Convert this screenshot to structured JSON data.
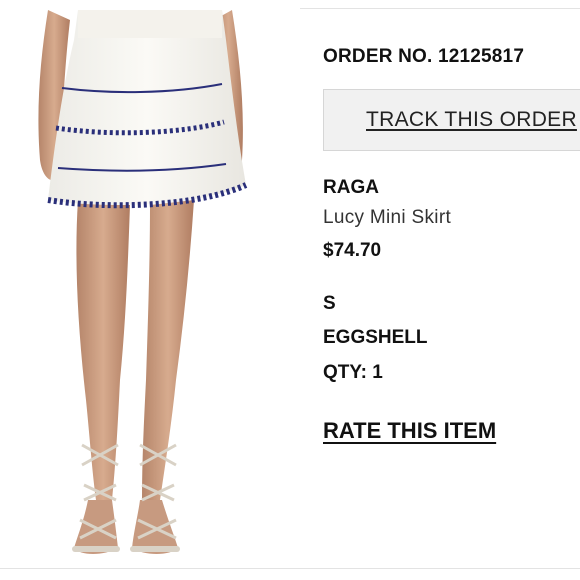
{
  "order": {
    "number_label": "ORDER NO. 12125817",
    "track_button": "TRACK THIS ORDER"
  },
  "item": {
    "brand": "RAGA",
    "name": "Lucy Mini Skirt",
    "price": "$74.70",
    "size": "S",
    "color": "EGGSHELL",
    "qty": "QTY: 1",
    "rate_link": "RATE THIS ITEM"
  },
  "photo": {
    "skirt_color": "#f7f5f0",
    "trim_color": "#2a2f7a",
    "skin_color": "#c99a7c",
    "sandal_color": "#d9d2c6"
  }
}
